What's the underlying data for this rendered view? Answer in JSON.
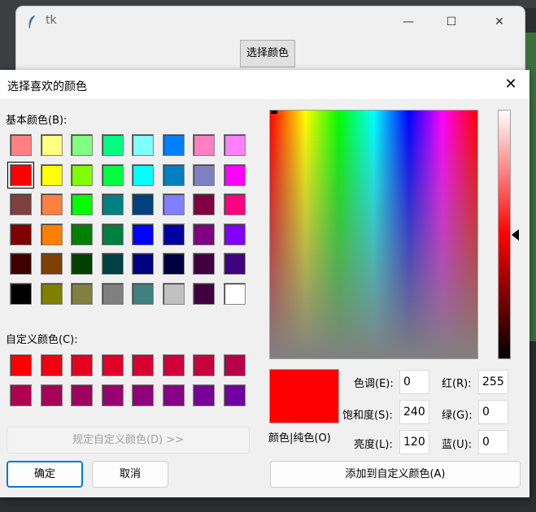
{
  "tk_window": {
    "title": "tk",
    "pick_button": "选择颜色",
    "min_label": "—",
    "max_label": "☐",
    "close_label": "✕"
  },
  "dialog": {
    "title": "选择喜欢的颜色",
    "close_label": "✕",
    "basic_colors_label": "基本颜色(B):",
    "custom_colors_label": "自定义颜色(C):",
    "define_custom_button": "规定自定义颜色(D) >>",
    "ok_button": "确定",
    "cancel_button": "取消",
    "add_custom_button": "添加到自定义颜色(A)",
    "preview_label": "颜色|纯色(O)",
    "preview_color": "#ff0000",
    "fields": {
      "hue_label": "色调(E):",
      "hue": "0",
      "sat_label": "饱和度(S):",
      "sat": "240",
      "lum_label": "亮度(L):",
      "lum": "120",
      "red_label": "红(R):",
      "red": "255",
      "green_label": "绿(G):",
      "green": "0",
      "blue_label": "蓝(U):",
      "blue": "0"
    },
    "basic_colors": [
      "#ff8080",
      "#ffff80",
      "#80ff80",
      "#00ff80",
      "#80ffff",
      "#0080ff",
      "#ff80c0",
      "#ff80ff",
      "#ff0000",
      "#ffff00",
      "#80ff00",
      "#00ff40",
      "#00ffff",
      "#0080c0",
      "#8080c0",
      "#ff00ff",
      "#804040",
      "#ff8040",
      "#00ff00",
      "#008080",
      "#004080",
      "#8080ff",
      "#800040",
      "#ff0080",
      "#800000",
      "#ff8000",
      "#008000",
      "#008040",
      "#0000ff",
      "#0000a0",
      "#800080",
      "#8000ff",
      "#400000",
      "#804000",
      "#004000",
      "#004040",
      "#000080",
      "#000040",
      "#400040",
      "#400080",
      "#000000",
      "#808000",
      "#808040",
      "#808080",
      "#408080",
      "#c0c0c0",
      "#400040",
      "#ffffff"
    ],
    "selected_basic_index": 8,
    "custom_colors": [
      "#ff0000",
      "#f00010",
      "#e60020",
      "#e00028",
      "#d80030",
      "#d00038",
      "#c80040",
      "#b80048",
      "#b00050",
      "#a80058",
      "#a00060",
      "#980070",
      "#900078",
      "#880088",
      "#780098",
      "#7000a0"
    ]
  }
}
